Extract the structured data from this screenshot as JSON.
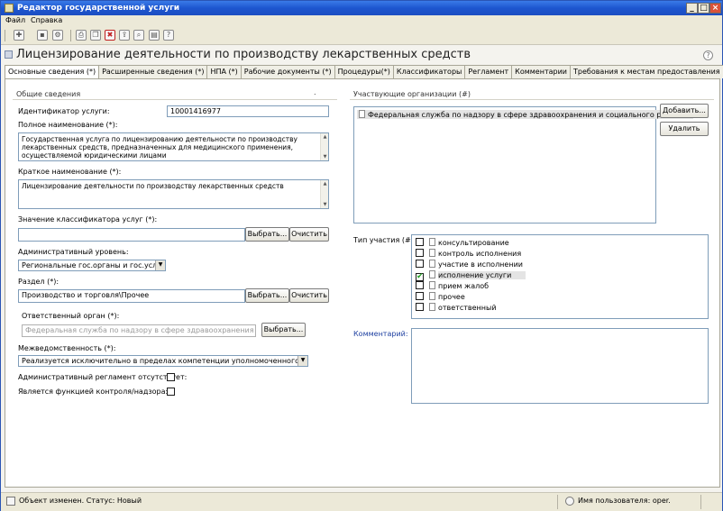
{
  "window": {
    "title": "Редактор государственной услуги"
  },
  "menu": {
    "file": "Файл",
    "help": "Справка"
  },
  "header": {
    "title": "Лицензирование деятельности по производству лекарственных средств"
  },
  "tabs": [
    {
      "label": "Основные сведения (*)"
    },
    {
      "label": "Расширенные сведения (*)"
    },
    {
      "label": "НПА (*)"
    },
    {
      "label": "Рабочие документы (*)"
    },
    {
      "label": "Процедуры(*)"
    },
    {
      "label": "Классификаторы"
    },
    {
      "label": "Регламент"
    },
    {
      "label": "Комментарии"
    },
    {
      "label": "Требования к местам предоставления"
    }
  ],
  "general": {
    "section_title": "Общие сведения",
    "id_label": "Идентификатор услуги:",
    "id_value": "10001416977",
    "fullname_label": "Полное наименование (*):",
    "fullname_value": "Государственная услуга по лицензированию деятельности по производству лекарственных средств, предназначенных для медицинского применения, осуществляемой юридическими лицами",
    "shortname_label": "Краткое наименование (*):",
    "shortname_value": "Лицензирование деятельности по производству лекарственных средств",
    "classifier_label": "Значение классификатора услуг (*):",
    "classifier_value": "",
    "admin_level_label": "Административный уровень:",
    "admin_level_value": "Региональные гос.органы и гос.услуги",
    "section_label": "Раздел (*):",
    "section_value": "Производство и торговля\\Прочее",
    "resp_label": "Ответственный орган (*):",
    "resp_value": "Федеральная служба по надзору в сфере здравоохранения и социальн",
    "interdept_label": "Межведомственность (*):",
    "interdept_value": "Реализуется исключительно в пределах компетенции уполномоченного органа вла",
    "no_regulation_label": "Административный регламент отсутствует:",
    "control_label": "Является функцией контроля/надзора:",
    "dot": "."
  },
  "buttons": {
    "choose": "Выбрать...",
    "clear": "Очистить",
    "add": "Добавить...",
    "delete": "Удалить"
  },
  "orgs": {
    "section_title": "Участвующие организации (#)",
    "items": [
      "Федеральная служба по надзору в сфере здравоохранения и социального развития"
    ],
    "participation_label": "Тип участия (#):",
    "participation": [
      {
        "label": "консультирование",
        "checked": false
      },
      {
        "label": "контроль исполнения",
        "checked": false
      },
      {
        "label": "участие в исполнении",
        "checked": false
      },
      {
        "label": "исполнение услуги",
        "checked": true
      },
      {
        "label": "прием жалоб",
        "checked": false
      },
      {
        "label": "прочее",
        "checked": false
      },
      {
        "label": "ответственный",
        "checked": false
      }
    ],
    "comment_label": "Комментарий:"
  },
  "status": {
    "left": "Объект изменен. Статус: Новый",
    "right": "Имя пользователя: oper."
  }
}
